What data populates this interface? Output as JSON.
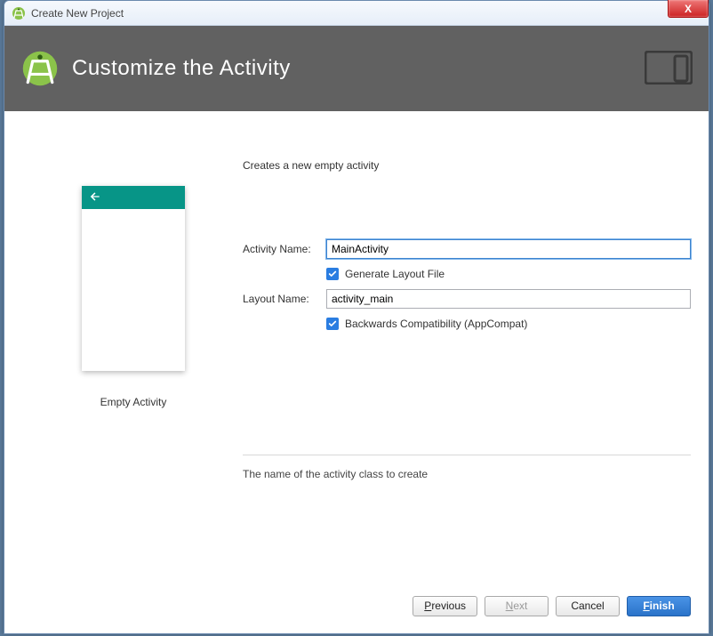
{
  "window": {
    "title": "Create New Project"
  },
  "banner": {
    "heading": "Customize the Activity"
  },
  "preview": {
    "label": "Empty Activity"
  },
  "form": {
    "description": "Creates a new empty activity",
    "activity_name_label": "Activity Name:",
    "activity_name_value": "MainActivity",
    "generate_layout_label": "Generate Layout File",
    "layout_name_label": "Layout Name:",
    "layout_name_value": "activity_main",
    "backcompat_label": "Backwards Compatibility (AppCompat)",
    "hint": "The name of the activity class to create"
  },
  "buttons": {
    "previous": "Previous",
    "next": "Next",
    "cancel": "Cancel",
    "finish": "Finish"
  },
  "icons": {
    "close": "X"
  },
  "colors": {
    "accent": "#2a7de1",
    "teal": "#079587",
    "banner": "#616161"
  }
}
